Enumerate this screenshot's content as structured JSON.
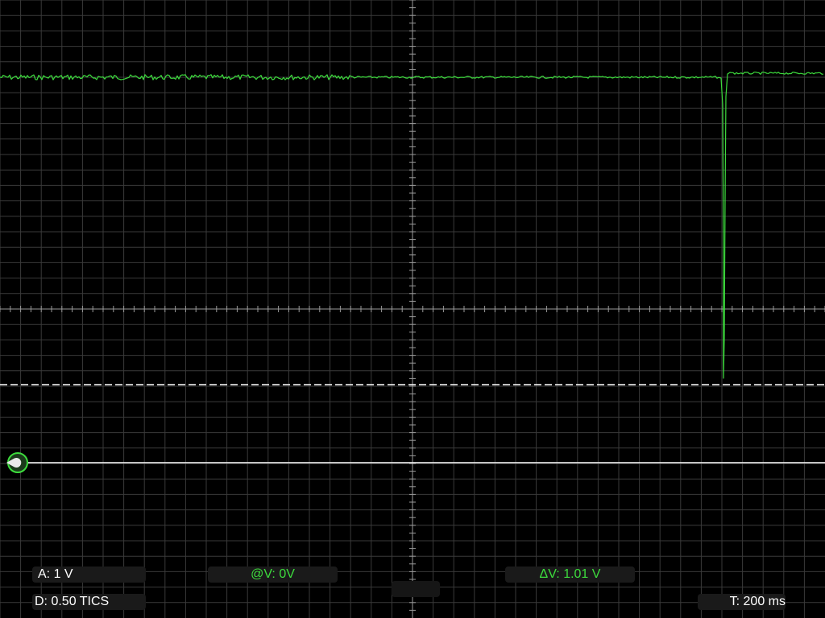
{
  "scope": {
    "trace_color": "#3ddc3d",
    "grid_color": "#3a3a3a",
    "axis_color": "#9a9a9a",
    "cursor_line_color": "#ffffff"
  },
  "readouts": {
    "amplitude": "A: 1 V",
    "divisions": "D: 0.50  TICS",
    "cursor_voltage": "@V: 0V",
    "delta_voltage": "ΔV: 1.01 V",
    "timebase": "T: 200 ms"
  },
  "markers": {
    "ground_marker_icon": "ground-level-marker"
  }
}
